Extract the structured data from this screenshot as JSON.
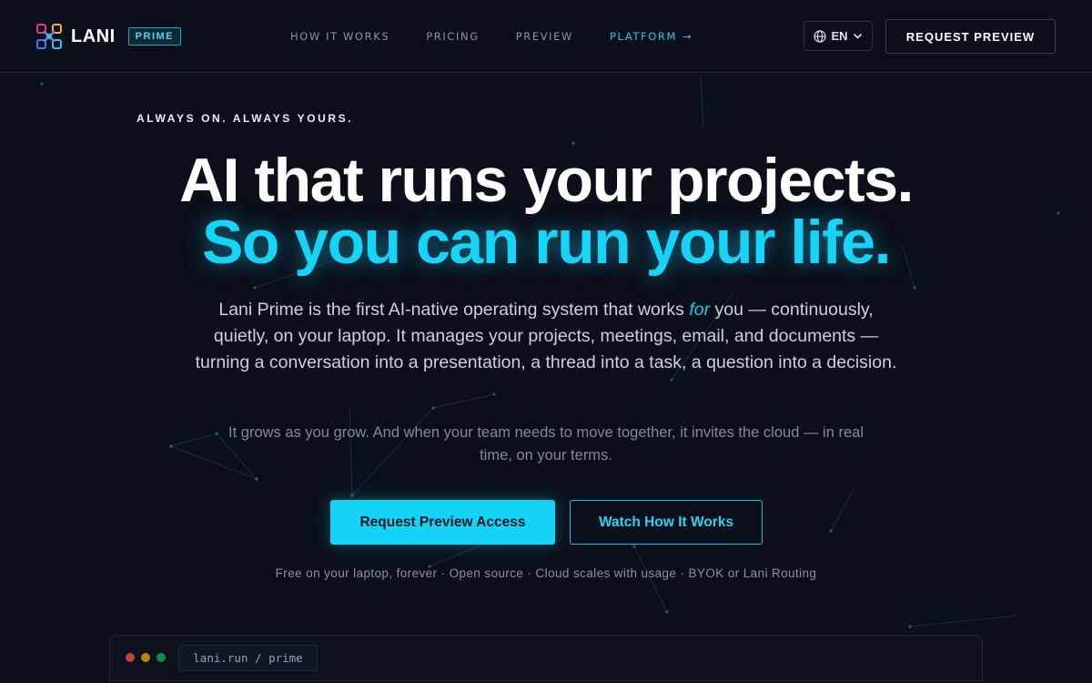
{
  "brand": {
    "name": "LANI",
    "badge": "PRIME",
    "colors": {
      "accent": "#17d3f7",
      "background": "#0b0f1a"
    }
  },
  "nav": {
    "items": [
      {
        "label": "HOW IT WORKS"
      },
      {
        "label": "PRICING"
      },
      {
        "label": "PREVIEW"
      },
      {
        "label": "PLATFORM",
        "icon": "arrow-right-icon"
      }
    ]
  },
  "header": {
    "language": {
      "label": "EN",
      "icon": "globe-icon",
      "caret": "chevron-down-icon"
    },
    "cta_label": "REQUEST PREVIEW"
  },
  "hero": {
    "eyebrow": "ALWAYS ON. ALWAYS YOURS.",
    "headline": "AI that runs your projects.",
    "subhead": "So you can run your life.",
    "lede_before": "Lani Prime is the first AI-native operating system that works ",
    "lede_emphasis": "for",
    "lede_after": " you — continuously, quietly, on your laptop. It manages your projects, meetings, email, and documents — turning a conversation into a presentation, a thread into a task, a question into a decision.",
    "lede2": "It grows as you grow. And when your team needs to move together, it invites the cloud — in real time, on your terms.",
    "primary_cta": "Request Preview Access",
    "secondary_cta": "Watch How It Works",
    "fineprint": "Free on your laptop, forever · Open source · Cloud scales with usage · BYOK or Lani Routing"
  },
  "browser": {
    "url": "lani.run / prime"
  }
}
